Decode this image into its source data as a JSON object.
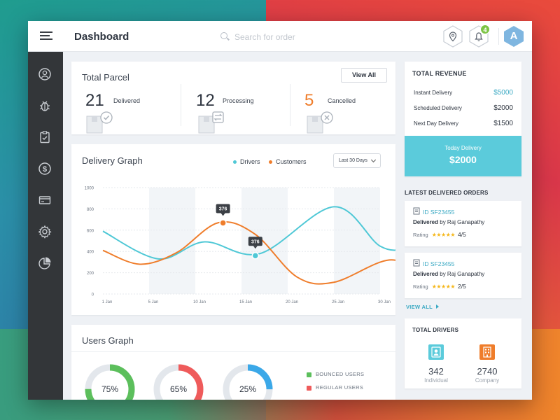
{
  "header": {
    "title": "Dashboard",
    "search_placeholder": "Search for order",
    "notification_count": "4",
    "avatar_letter": "A"
  },
  "sidebar": {
    "items": [
      {
        "icon": "user-icon"
      },
      {
        "icon": "bug-icon"
      },
      {
        "icon": "clipboard-icon"
      },
      {
        "icon": "dollar-icon"
      },
      {
        "icon": "card-icon"
      },
      {
        "icon": "gear-icon"
      },
      {
        "icon": "pie-chart-icon"
      }
    ]
  },
  "parcel": {
    "title": "Total Parcel",
    "view_all": "View All",
    "stats": [
      {
        "value": "21",
        "label": "Delivered",
        "color": "#2e3540"
      },
      {
        "value": "12",
        "label": "Processing",
        "color": "#2e3540"
      },
      {
        "value": "5",
        "label": "Cancelled",
        "color": "#ef7d2b"
      }
    ]
  },
  "graph": {
    "title": "Delivery Graph",
    "range": "Last 30 Days"
  },
  "chart_data": {
    "type": "line",
    "title": "Delivery Graph",
    "x": [
      "1 Jan",
      "5 Jan",
      "10 Jan",
      "15 Jan",
      "20 Jan",
      "25 Jan",
      "30 Jan"
    ],
    "ylim": [
      0,
      1000
    ],
    "yticks": [
      0,
      200,
      400,
      600,
      800,
      1000
    ],
    "series": [
      {
        "name": "Drivers",
        "color": "#4fc8d6",
        "points": [
          [
            0,
            590
          ],
          [
            1.2,
            330
          ],
          [
            2.2,
            490
          ],
          [
            3.4,
            380
          ],
          [
            5.0,
            820
          ],
          [
            6.0,
            450
          ],
          [
            6.6,
            440
          ],
          [
            7.0,
            600
          ]
        ]
      },
      {
        "name": "Customers",
        "color": "#ef7d2b",
        "points": [
          [
            0,
            410
          ],
          [
            0.8,
            280
          ],
          [
            1.6,
            390
          ],
          [
            2.5,
            670
          ],
          [
            3.3,
            560
          ],
          [
            4.2,
            160
          ],
          [
            5.0,
            110
          ],
          [
            6.2,
            320
          ],
          [
            7.0,
            180
          ]
        ]
      }
    ],
    "tooltips": [
      {
        "series": "Customers",
        "x": 2.6,
        "y": 668,
        "label": "376"
      },
      {
        "series": "Drivers",
        "x": 3.3,
        "y": 360,
        "label": "376"
      }
    ]
  },
  "users": {
    "title": "Users Graph",
    "donuts": [
      {
        "label": "75%",
        "value": 0.75,
        "color": "#5cbf5c"
      },
      {
        "label": "65%",
        "value": 0.65,
        "color": "#ef5b5b"
      },
      {
        "label": "25%",
        "value": 0.25,
        "color": "#3ba8e8"
      }
    ],
    "legend": [
      {
        "label": "BOUNCED USERS",
        "color": "#5cbf5c"
      },
      {
        "label": "REGULAR USERS",
        "color": "#ef5b5b"
      }
    ]
  },
  "revenue": {
    "title": "TOTAL REVENUE",
    "rows": [
      {
        "label": "Instant Delivery",
        "value": "$5000",
        "color": "#3aa9c3"
      },
      {
        "label": "Scheduled Delivery",
        "value": "$2000",
        "color": "#2e3540"
      },
      {
        "label": "Next Day Delivery",
        "value": "$1500",
        "color": "#2e3540"
      }
    ],
    "today_label": "Today Delivery",
    "today_value": "$2000"
  },
  "orders": {
    "title": "LATEST DELIVERED ORDERS",
    "items": [
      {
        "id": "ID SF23455",
        "status": "Delivered",
        "by": " by Raj Ganapathy",
        "rating_label": "Rating",
        "stars": "★★★★★",
        "rating": "4/5"
      },
      {
        "id": "ID SF23455",
        "status": "Delivered",
        "by": " by Raj Ganapathy",
        "rating_label": "Rating",
        "stars": "★★★★★",
        "rating": "2/5"
      }
    ],
    "view_all": "VIEW ALL"
  },
  "drivers": {
    "title": "TOTAL DRIVERS",
    "items": [
      {
        "value": "342",
        "label": "Individual",
        "color": "#5bcbdb"
      },
      {
        "value": "2740",
        "label": "Company",
        "color": "#ef7d2b"
      }
    ]
  }
}
